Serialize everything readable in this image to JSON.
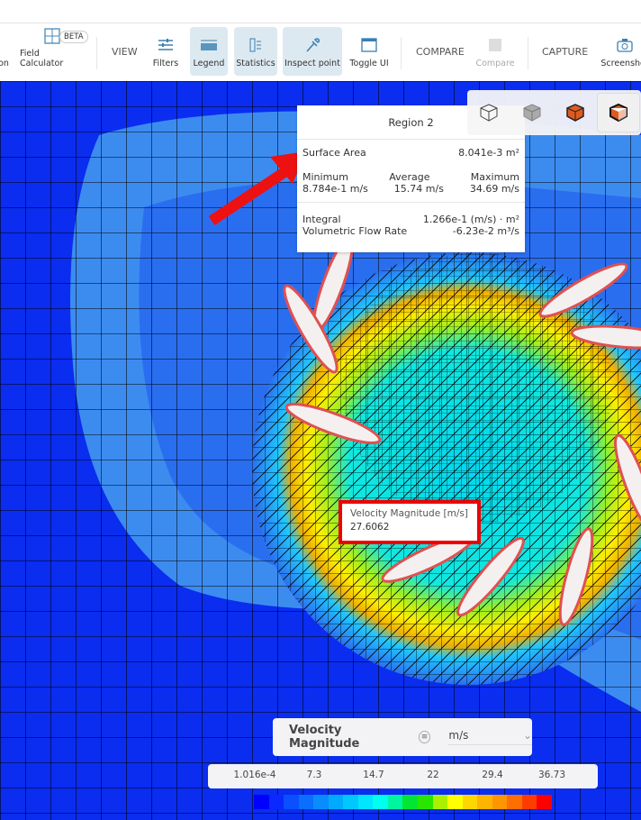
{
  "toolbar": {
    "partial_label": "on",
    "field_calculator": "Field Calculator",
    "beta_badge": "BETA",
    "view_section": "VIEW",
    "filters": "Filters",
    "legend": "Legend",
    "statistics": "Statistics",
    "inspect_point": "Inspect point",
    "toggle_ui": "Toggle UI",
    "compare_section": "COMPARE",
    "compare": "Compare",
    "capture_section": "CAPTURE",
    "screenshot": "Screenshot"
  },
  "stats": {
    "title": "Region 2",
    "surface_area_label": "Surface Area",
    "surface_area": "8.041e-3 m²",
    "min_label": "Minimum",
    "min": "8.784e-1 m/s",
    "avg_label": "Average",
    "avg": "15.74 m/s",
    "max_label": "Maximum",
    "max": "34.69 m/s",
    "integral_label": "Integral",
    "integral": "1.266e-1 (m/s) · m²",
    "flow_label": "Volumetric Flow Rate",
    "flow": "-6.23e-2 m³/s"
  },
  "probe": {
    "label": "Velocity Magnitude [m/s]",
    "value": "27.6062"
  },
  "legend": {
    "field": "Velocity Magnitude",
    "unit": "m/s",
    "ticks": [
      "1.016e-4",
      "7.3",
      "14.7",
      "22",
      "29.4",
      "36.73"
    ],
    "colors": [
      "#0000ff",
      "#0a28ff",
      "#0a50ff",
      "#0a6eff",
      "#0a8cff",
      "#00aaff",
      "#00c8ff",
      "#00e6ff",
      "#00ffee",
      "#00f5a0",
      "#00e632",
      "#28e600",
      "#aaf000",
      "#ffff00",
      "#ffd700",
      "#ffb400",
      "#ff9600",
      "#ff6e00",
      "#ff3c00",
      "#ff0000"
    ]
  },
  "colors": {
    "accent_active": "#dde9f1",
    "annotation_red": "#ee0000",
    "background_flow": "#0a2df0"
  }
}
